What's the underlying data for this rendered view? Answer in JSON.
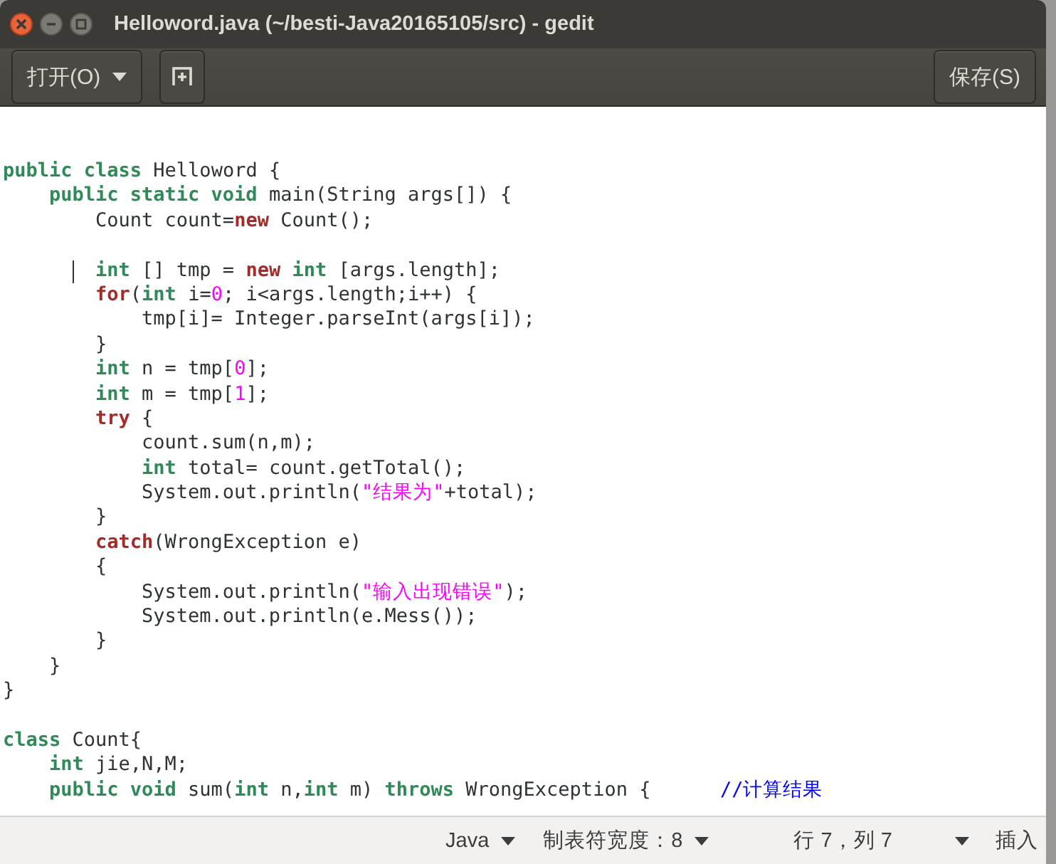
{
  "window": {
    "title": "Helloword.java (~/besti-Java20165105/src) - gedit"
  },
  "header_bar": {
    "open_button": "打开(O)",
    "save_button": "保存(S)"
  },
  "editor": {
    "lines": [
      {
        "kind": "code",
        "tokens": [
          {
            "kind": "type",
            "text": "public class"
          },
          {
            "kind": "plain",
            "text": " Helloword {"
          }
        ]
      },
      {
        "kind": "code",
        "tokens": [
          {
            "kind": "type",
            "text": "    public static void"
          },
          {
            "kind": "plain",
            "text": " main(String args[]) {"
          }
        ]
      },
      {
        "kind": "code",
        "tokens": [
          {
            "kind": "plain",
            "text": "        Count count="
          },
          {
            "kind": "keyword",
            "text": "new"
          },
          {
            "kind": "plain",
            "text": " Count();"
          }
        ]
      },
      {
        "kind": "blank"
      },
      {
        "kind": "code",
        "caret": true,
        "tokens": [
          {
            "kind": "type",
            "text": "        int"
          },
          {
            "kind": "plain",
            "text": " [] tmp = "
          },
          {
            "kind": "keyword",
            "text": "new"
          },
          {
            "kind": "type",
            "text": " int"
          },
          {
            "kind": "plain",
            "text": " [args.length];"
          }
        ]
      },
      {
        "kind": "code",
        "tokens": [
          {
            "kind": "keyword",
            "text": "        for"
          },
          {
            "kind": "plain",
            "text": "("
          },
          {
            "kind": "type",
            "text": "int"
          },
          {
            "kind": "plain",
            "text": " i="
          },
          {
            "kind": "number",
            "text": "0"
          },
          {
            "kind": "plain",
            "text": "; i<args.length;i++) {"
          }
        ]
      },
      {
        "kind": "code",
        "tokens": [
          {
            "kind": "plain",
            "text": "            tmp[i]= Integer.parseInt(args[i]);"
          }
        ]
      },
      {
        "kind": "code",
        "tokens": [
          {
            "kind": "plain",
            "text": "        }"
          }
        ]
      },
      {
        "kind": "code",
        "tokens": [
          {
            "kind": "type",
            "text": "        int"
          },
          {
            "kind": "plain",
            "text": " n = tmp["
          },
          {
            "kind": "number",
            "text": "0"
          },
          {
            "kind": "plain",
            "text": "];"
          }
        ]
      },
      {
        "kind": "code",
        "tokens": [
          {
            "kind": "type",
            "text": "        int"
          },
          {
            "kind": "plain",
            "text": " m = tmp["
          },
          {
            "kind": "number",
            "text": "1"
          },
          {
            "kind": "plain",
            "text": "];"
          }
        ]
      },
      {
        "kind": "code",
        "tokens": [
          {
            "kind": "keyword",
            "text": "        try"
          },
          {
            "kind": "plain",
            "text": " {"
          }
        ]
      },
      {
        "kind": "code",
        "tokens": [
          {
            "kind": "plain",
            "text": "            count.sum(n,m);"
          }
        ]
      },
      {
        "kind": "code",
        "tokens": [
          {
            "kind": "type",
            "text": "            int"
          },
          {
            "kind": "plain",
            "text": " total= count.getTotal();"
          }
        ]
      },
      {
        "kind": "code",
        "tokens": [
          {
            "kind": "plain",
            "text": "            System.out.println("
          },
          {
            "kind": "string",
            "text": "\"结果为\""
          },
          {
            "kind": "plain",
            "text": "+total);"
          }
        ]
      },
      {
        "kind": "code",
        "tokens": [
          {
            "kind": "plain",
            "text": "        }"
          }
        ]
      },
      {
        "kind": "code",
        "tokens": [
          {
            "kind": "keyword",
            "text": "        catch"
          },
          {
            "kind": "plain",
            "text": "(WrongException e)"
          }
        ]
      },
      {
        "kind": "code",
        "tokens": [
          {
            "kind": "plain",
            "text": "        {"
          }
        ]
      },
      {
        "kind": "code",
        "tokens": [
          {
            "kind": "plain",
            "text": "            System.out.println("
          },
          {
            "kind": "string",
            "text": "\"输入出现错误\""
          },
          {
            "kind": "plain",
            "text": ");"
          }
        ]
      },
      {
        "kind": "code",
        "tokens": [
          {
            "kind": "plain",
            "text": "            System.out.println(e.Mess());"
          }
        ]
      },
      {
        "kind": "code",
        "tokens": [
          {
            "kind": "plain",
            "text": "        }"
          }
        ]
      },
      {
        "kind": "code",
        "tokens": [
          {
            "kind": "plain",
            "text": "    }"
          }
        ]
      },
      {
        "kind": "code",
        "tokens": [
          {
            "kind": "plain",
            "text": "}"
          }
        ]
      },
      {
        "kind": "blank"
      },
      {
        "kind": "code",
        "tokens": [
          {
            "kind": "type",
            "text": "class"
          },
          {
            "kind": "plain",
            "text": " Count{"
          }
        ]
      },
      {
        "kind": "code",
        "tokens": [
          {
            "kind": "type",
            "text": "    int"
          },
          {
            "kind": "plain",
            "text": " jie,N,M;"
          }
        ]
      },
      {
        "kind": "code",
        "tokens": [
          {
            "kind": "type",
            "text": "    public void"
          },
          {
            "kind": "plain",
            "text": " sum("
          },
          {
            "kind": "type",
            "text": "int"
          },
          {
            "kind": "plain",
            "text": " n,"
          },
          {
            "kind": "type",
            "text": "int"
          },
          {
            "kind": "plain",
            "text": " m)"
          },
          {
            "kind": "type",
            "text": " throws"
          },
          {
            "kind": "plain",
            "text": " WrongException {"
          },
          {
            "kind": "comment",
            "text": "      //计算结果"
          }
        ]
      }
    ]
  },
  "status_bar": {
    "language": "Java",
    "tab_width": "制表符宽度：8",
    "position": "行 7，列 7",
    "mode": "插入"
  }
}
